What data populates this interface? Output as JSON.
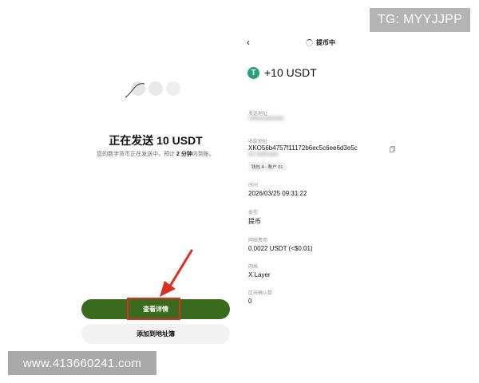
{
  "watermark": {
    "tg": "TG: MYYJJPP",
    "url": "www.413660241.com"
  },
  "left": {
    "title": "正在发送 10 USDT",
    "subtitle_before": "您的数字货币正在发送中，预计 ",
    "subtitle_bold": "2 分钟",
    "subtitle_after": "内到账。",
    "primary_button": "查看详情",
    "secondary_button": "添加到地址簿"
  },
  "right": {
    "back": "‹",
    "header_title": "提币中",
    "token_symbol": "T",
    "amount": "+10 USDT",
    "fields": {
      "from_label": "发送地址",
      "from_value": "0x8f2a1d93cb4e",
      "to_label": "收款地址",
      "to_value_line1": "XKO56b4757f11172b6ec5c6ee6d3e5c",
      "to_value_line2": "b373e8ff1b8fc",
      "wallet_chip": "钱包 A · 账户 01",
      "time_label": "时间",
      "time_value": "2026/03/25 09:31:22",
      "type_label": "类型",
      "type_value": "提币",
      "fee_label": "网络费用",
      "fee_value": "0.0022 USDT (<$0.01)",
      "network_label": "网络",
      "network_value": "X Layer",
      "confirm_label": "区块确认数",
      "confirm_value": "0"
    }
  },
  "colors": {
    "primary_green": "#3a6b1d",
    "usdt_green": "#26a17b",
    "highlight_red": "#d9301f"
  },
  "icons": [
    "loading-dots-icon",
    "back-arrow-icon",
    "spinner-icon",
    "usdt-icon",
    "copy-icon",
    "red-arrow-icon"
  ]
}
